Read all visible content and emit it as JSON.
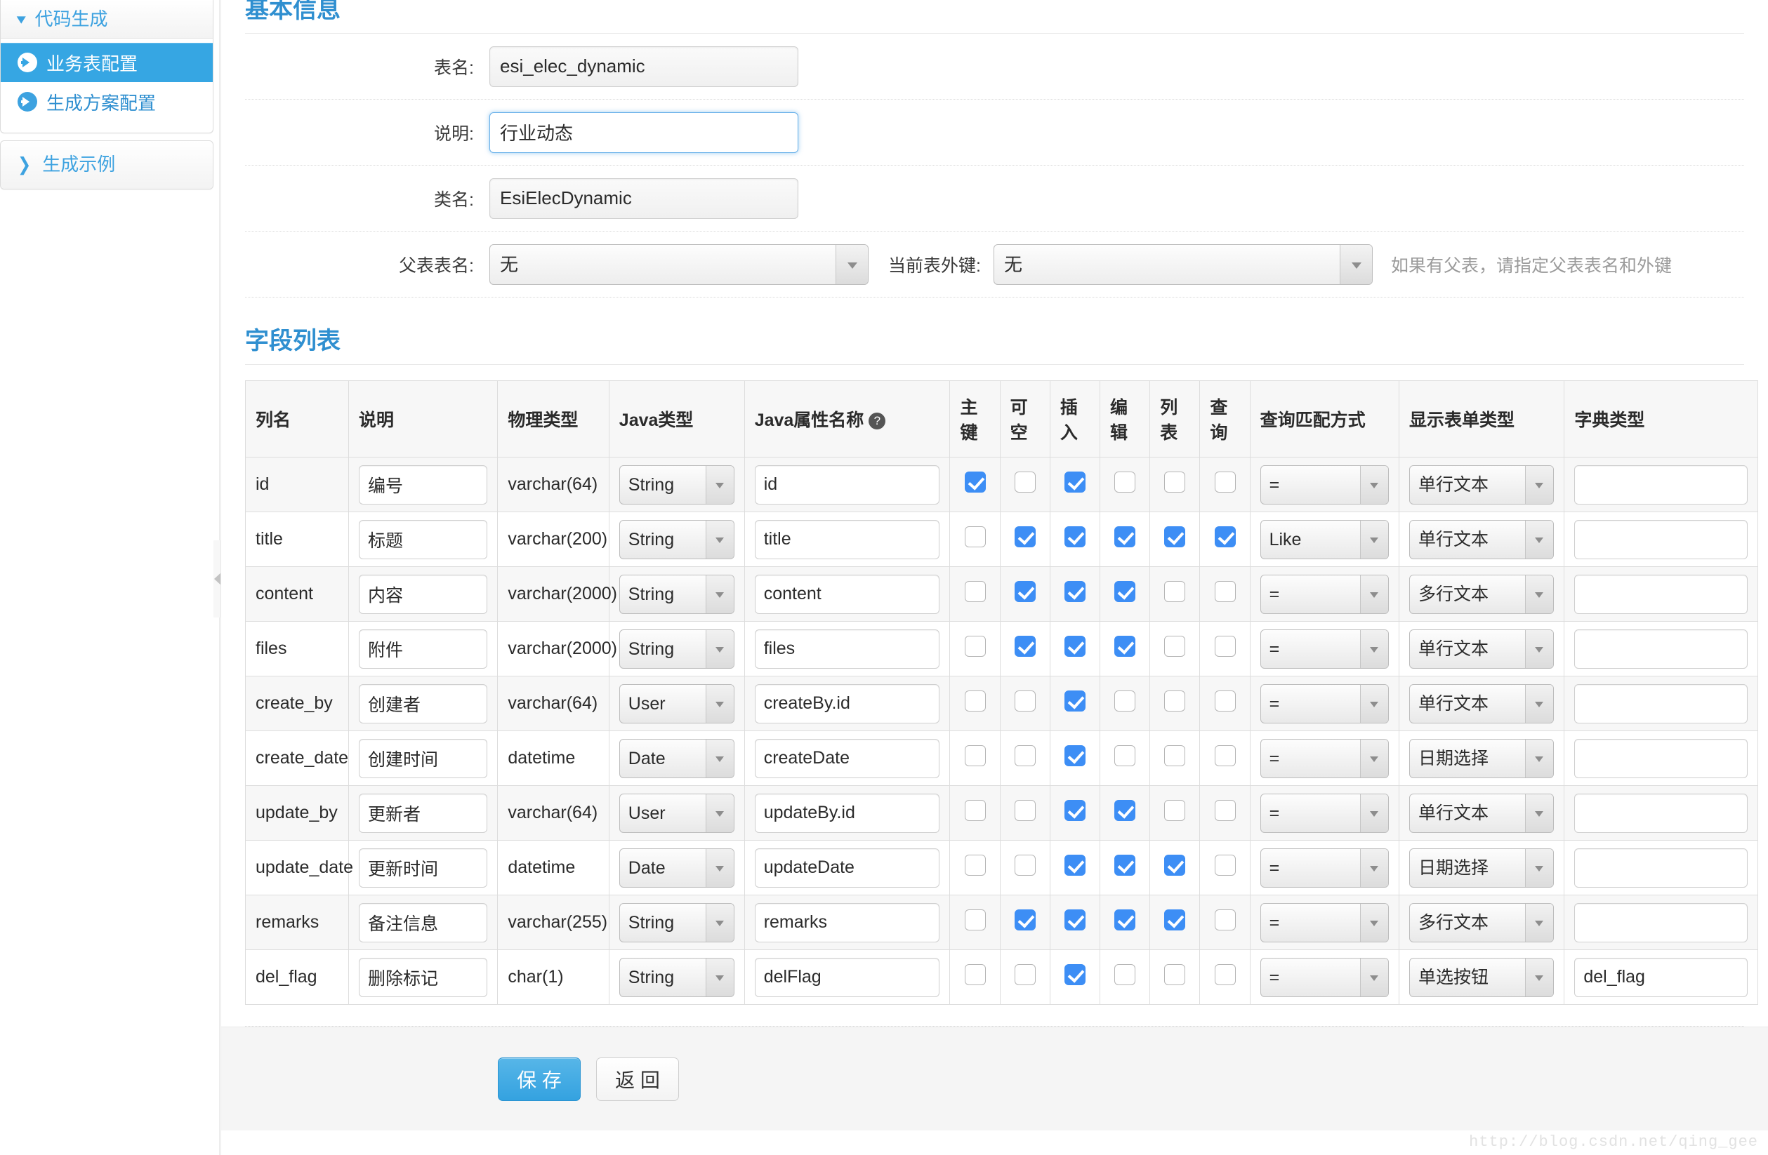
{
  "sidebar": {
    "groups": [
      {
        "title": "代码生成",
        "chevron": "chevron-down-icon",
        "items": [
          {
            "label": "业务表配置",
            "active": true
          },
          {
            "label": "生成方案配置",
            "active": false
          }
        ]
      },
      {
        "title": "生成示例",
        "chevron": "chevron-right-icon",
        "items": []
      }
    ]
  },
  "basic": {
    "title": "基本信息",
    "fields": {
      "table_name_label": "表名:",
      "table_name_value": "esi_elec_dynamic",
      "description_label": "说明:",
      "description_value": "行业动态",
      "class_name_label": "类名:",
      "class_name_value": "EsiElecDynamic",
      "parent_table_label": "父表表名:",
      "parent_table_value": "无",
      "foreign_key_label": "当前表外键:",
      "foreign_key_value": "无",
      "hint": "如果有父表，请指定父表表名和外键"
    }
  },
  "fieldList": {
    "title": "字段列表",
    "columns": [
      "列名",
      "说明",
      "物理类型",
      "Java类型",
      "Java属性名称",
      "主键",
      "可空",
      "插入",
      "编辑",
      "列表",
      "查询",
      "查询匹配方式",
      "显示表单类型",
      "字典类型"
    ],
    "help_icon": "question-mark-icon",
    "rows": [
      {
        "column": "id",
        "comment": "编号",
        "jdbc_type": "varchar(64)",
        "java_type": "String",
        "java_field": "id",
        "pk": true,
        "nullable": false,
        "insert": true,
        "edit": false,
        "list": false,
        "query": false,
        "query_type": "=",
        "show_type": "单行文本",
        "dict_type": ""
      },
      {
        "column": "title",
        "comment": "标题",
        "jdbc_type": "varchar(200)",
        "java_type": "String",
        "java_field": "title",
        "pk": false,
        "nullable": true,
        "insert": true,
        "edit": true,
        "list": true,
        "query": true,
        "query_type": "Like",
        "show_type": "单行文本",
        "dict_type": ""
      },
      {
        "column": "content",
        "comment": "内容",
        "jdbc_type": "varchar(2000)",
        "java_type": "String",
        "java_field": "content",
        "pk": false,
        "nullable": true,
        "insert": true,
        "edit": true,
        "list": false,
        "query": false,
        "query_type": "=",
        "show_type": "多行文本",
        "dict_type": ""
      },
      {
        "column": "files",
        "comment": "附件",
        "jdbc_type": "varchar(2000)",
        "java_type": "String",
        "java_field": "files",
        "pk": false,
        "nullable": true,
        "insert": true,
        "edit": true,
        "list": false,
        "query": false,
        "query_type": "=",
        "show_type": "单行文本",
        "dict_type": ""
      },
      {
        "column": "create_by",
        "comment": "创建者",
        "jdbc_type": "varchar(64)",
        "java_type": "User",
        "java_field": "createBy.id",
        "pk": false,
        "nullable": false,
        "insert": true,
        "edit": false,
        "list": false,
        "query": false,
        "query_type": "=",
        "show_type": "单行文本",
        "dict_type": ""
      },
      {
        "column": "create_date",
        "comment": "创建时间",
        "jdbc_type": "datetime",
        "java_type": "Date",
        "java_field": "createDate",
        "pk": false,
        "nullable": false,
        "insert": true,
        "edit": false,
        "list": false,
        "query": false,
        "query_type": "=",
        "show_type": "日期选择",
        "dict_type": ""
      },
      {
        "column": "update_by",
        "comment": "更新者",
        "jdbc_type": "varchar(64)",
        "java_type": "User",
        "java_field": "updateBy.id",
        "pk": false,
        "nullable": false,
        "insert": true,
        "edit": true,
        "list": false,
        "query": false,
        "query_type": "=",
        "show_type": "单行文本",
        "dict_type": ""
      },
      {
        "column": "update_date",
        "comment": "更新时间",
        "jdbc_type": "datetime",
        "java_type": "Date",
        "java_field": "updateDate",
        "pk": false,
        "nullable": false,
        "insert": true,
        "edit": true,
        "list": true,
        "query": false,
        "query_type": "=",
        "show_type": "日期选择",
        "dict_type": ""
      },
      {
        "column": "remarks",
        "comment": "备注信息",
        "jdbc_type": "varchar(255)",
        "java_type": "String",
        "java_field": "remarks",
        "pk": false,
        "nullable": true,
        "insert": true,
        "edit": true,
        "list": true,
        "query": false,
        "query_type": "=",
        "show_type": "多行文本",
        "dict_type": ""
      },
      {
        "column": "del_flag",
        "comment": "删除标记",
        "jdbc_type": "char(1)",
        "java_type": "String",
        "java_field": "delFlag",
        "pk": false,
        "nullable": false,
        "insert": true,
        "edit": false,
        "list": false,
        "query": false,
        "query_type": "=",
        "show_type": "单选按钮",
        "dict_type": "del_flag"
      }
    ]
  },
  "footer": {
    "save_label": "保 存",
    "back_label": "返 回"
  },
  "watermark": "http://blog.csdn.net/qing_gee",
  "colors": {
    "accent": "#36a6e3",
    "link": "#2f8fd0",
    "checkbox_on": "#3d8ef5",
    "header_bg": "#f7f7f7"
  }
}
